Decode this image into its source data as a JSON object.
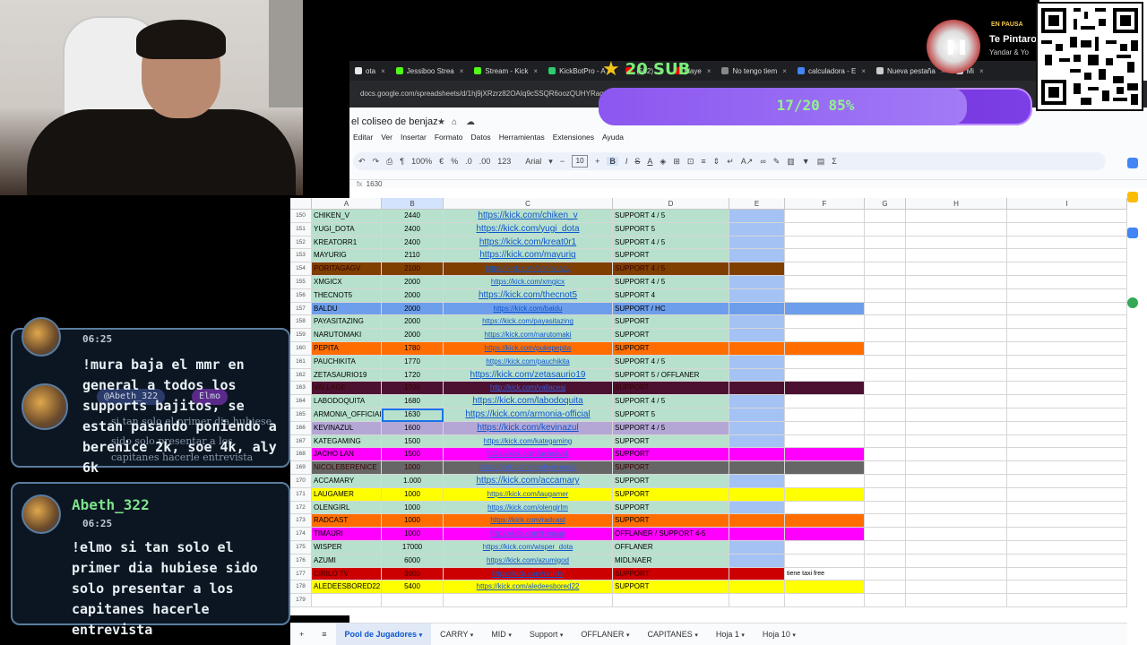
{
  "overlay": {
    "sub_count": "20 SUB",
    "progress_text": "17/20  85%",
    "progress_fraction": 0.85,
    "music_status": "EN PAUSA",
    "music_title": "Te Pintaro",
    "music_artist": "Yandar & Yo"
  },
  "chat": {
    "msg1_time": "06:25",
    "msg1_text": "!mura baja el mmr en general a todos los supports bajitos, se estan pasando poniendo a berenice 2k, soe 4k, aly 6k",
    "ghost_tag1": "@Abeth_322",
    "ghost_tag2": "Elmo",
    "ghost_text1": "si tan solo el primer dia hubiese",
    "ghost_text2": "sido solo presentar a los",
    "ghost_text3": "capitanes hacerle entrevista",
    "msg2_user": "Abeth_322",
    "msg2_time": "06:25",
    "msg2_text": "!elmo si tan solo el primer dia hubiese sido solo presentar a los capitanes hacerle entrevista"
  },
  "browser": {
    "tabs": [
      {
        "label": "ota",
        "color": "#e7e7e7"
      },
      {
        "label": "Jessiboo Strea",
        "color": "#53fc18"
      },
      {
        "label": "Stream - Kick",
        "color": "#53fc18"
      },
      {
        "label": "KickBotPro - A",
        "color": "#2ecc71"
      },
      {
        "label": "(502)",
        "color": "#ff0000"
      },
      {
        "label": "playe",
        "color": "#ff0000"
      },
      {
        "label": "No tengo tiem",
        "color": "#888888"
      },
      {
        "label": "calculadora - E",
        "color": "#4285f4"
      },
      {
        "label": "Nueva pestaña",
        "color": "#cccccc"
      },
      {
        "label": "Mi",
        "color": "#cccccc"
      }
    ],
    "url": "docs.google.com/spreadsheets/d/1hj9jXRzrz82OAIq9cSSQR6oozQUHYRagcCXHCaaIH5"
  },
  "sheet": {
    "doc_name": "el coliseo de benjaz",
    "menus": [
      "Editar",
      "Ver",
      "Insertar",
      "Formato",
      "Datos",
      "Herramientas",
      "Extensiones",
      "Ayuda"
    ],
    "zoom": "100%",
    "font": "Arial",
    "font_size": "10",
    "formula_value": "1630",
    "col_headers": [
      "A",
      "B",
      "C",
      "D",
      "E",
      "F",
      "G",
      "H",
      "I"
    ],
    "rows": [
      {
        "n": "150",
        "a": "CHIKEN_V",
        "b": "2440",
        "c": "https://kick.com/chiken_v",
        "d": "SUPPORT 4 / 5",
        "bg": "#b7e1cd",
        "ext": false,
        "big": true
      },
      {
        "n": "151",
        "a": "YUGI_DOTA",
        "b": "2400",
        "c": "https://kick.com/yugi_dota",
        "d": "SUPPORT 5",
        "bg": "#b7e1cd",
        "ext": false,
        "big": true
      },
      {
        "n": "152",
        "a": "KREATORR1",
        "b": "2400",
        "c": "https://kick.com/kreat0r1",
        "d": "SUPPORT 4 / 5",
        "bg": "#b7e1cd",
        "ext": false,
        "big": true
      },
      {
        "n": "153",
        "a": "MAYURIG",
        "b": "2110",
        "c": "https://kick.com/mayurig",
        "d": "SUPPORT",
        "bg": "#b7e1cd",
        "ext": false,
        "big": true
      },
      {
        "n": "154",
        "a": "PORITAGAGV",
        "b": "2100",
        "c": "https://kick.com/poritagagv",
        "d": "SUPPORT 4 / 5",
        "bg": "#7f3f00",
        "ext": false,
        "dark": true
      },
      {
        "n": "155",
        "a": "XMGICX",
        "b": "2000",
        "c": "https://kick.com/xmgicx",
        "d": "SUPPORT 4 / 5",
        "bg": "#b7e1cd",
        "ext": false
      },
      {
        "n": "156",
        "a": "THECNOT5",
        "b": "2000",
        "c": "https://kick.com/thecnot5",
        "d": "SUPPORT 4",
        "bg": "#b7e1cd",
        "ext": false,
        "big": true
      },
      {
        "n": "157",
        "a": "BALDU",
        "b": "2000",
        "c": "https://kick.com/baldu",
        "d": "SUPPORT / HC",
        "bg": "#6d9eeb",
        "ext": true
      },
      {
        "n": "158",
        "a": "PAYASITAZING",
        "b": "2000",
        "c": "https://kick.com/payasitazing",
        "d": "SUPPORT",
        "bg": "#b7e1cd",
        "ext": false
      },
      {
        "n": "159",
        "a": "NARUTOMAKI",
        "b": "2000",
        "c": "https://kick.com/narutomaki",
        "d": "SUPPORT",
        "bg": "#b7e1cd",
        "ext": false
      },
      {
        "n": "160",
        "a": "PEPITA",
        "b": "1780",
        "c": "https://kick.com/pukepepita",
        "d": "SUPPORT",
        "bg": "#ff6d01",
        "ext": true
      },
      {
        "n": "161",
        "a": "PAUCHIKITA",
        "b": "1770",
        "c": "https://kick.com/pauchikita",
        "d": "SUPPORT 4 / 5",
        "bg": "#b7e1cd",
        "ext": false
      },
      {
        "n": "162",
        "a": "ZETASAURIO19",
        "b": "1720",
        "c": "https://kick.com/zetasaurio19",
        "d": "SUPPORT 5 / OFFLANER",
        "bg": "#b7e1cd",
        "ext": false,
        "big": true
      },
      {
        "n": "163",
        "a": "VALLAGE",
        "b": "1700",
        "c": "http://kick.com/vallacesj",
        "d": "SUPPORT",
        "bg": "#4c1130",
        "ext": true,
        "dark": true
      },
      {
        "n": "164",
        "a": "LABODOQUITA",
        "b": "1680",
        "c": "https://kick.com/labodoquita",
        "d": "SUPPORT 4 / 5",
        "bg": "#b7e1cd",
        "ext": false,
        "big": true
      },
      {
        "n": "165",
        "a": "ARMONIA_OFFICIAL",
        "b": "1630",
        "c": "https://kick.com/armonia-official",
        "d": "SUPPORT 5",
        "bg": "#b7e1cd",
        "ext": false,
        "big": true,
        "sel": true
      },
      {
        "n": "166",
        "a": "KEVINAZUL",
        "b": "1600",
        "c": "https://kick.com/kevinazul",
        "d": "SUPPORT 4 / 5",
        "bg": "#b4a7d6",
        "ext": false,
        "big": true
      },
      {
        "n": "167",
        "a": "KATEGAMING",
        "b": "1500",
        "c": "https://kick.com/kategaming",
        "d": "SUPPORT",
        "bg": "#b7e1cd",
        "ext": false
      },
      {
        "n": "168",
        "a": "JACHO LAN",
        "b": "1500",
        "c": "https://kick.com/jacholan1",
        "d": "SUPPORT",
        "bg": "#ff00ff",
        "ext": true
      },
      {
        "n": "169",
        "a": "NICOLEBERENICE",
        "b": "1000",
        "c": "https://kick.com/nicoleberenice",
        "d": "SUPPORT",
        "bg": "#666666",
        "ext": true,
        "dark": true
      },
      {
        "n": "170",
        "a": "ACCAMARY",
        "b": "1.000",
        "c": "https://kick.com/accamary",
        "d": "SUPPORT",
        "bg": "#b7e1cd",
        "ext": false,
        "big": true
      },
      {
        "n": "171",
        "a": "LAUGAMER",
        "b": "1000",
        "c": "https://kick.com/laugamer",
        "d": "SUPPORT",
        "bg": "#ffff00",
        "ext": true
      },
      {
        "n": "172",
        "a": "OLENGIRL",
        "b": "1000",
        "c": "https://kick.com/olengirlm",
        "d": "SUPPORT",
        "bg": "#b7e1cd",
        "ext": false
      },
      {
        "n": "173",
        "a": "RADCAST",
        "b": "1000",
        "c": "https://kick.com/radcast",
        "d": "SUPPORT",
        "bg": "#ff6d01",
        "ext": true
      },
      {
        "n": "174",
        "a": "TIMAURI",
        "b": "1000",
        "c": "https://kick.com/t-imauri",
        "d": "OFFLANER / SUPPORT 4-5",
        "bg": "#ff00ff",
        "ext": true
      },
      {
        "n": "175",
        "a": "WISPER",
        "b": "17000",
        "c": "https://kick.com/wisper_dota",
        "d": "OFFLANER",
        "bg": "#b7e1cd",
        "ext": false
      },
      {
        "n": "176",
        "a": "AZUMI",
        "b": "6000",
        "c": "https://kick.com/azumigod",
        "d": "MIDLNAER",
        "bg": "#b7e1cd",
        "ext": false
      },
      {
        "n": "177",
        "a": "CIRILO TV",
        "b": "3900",
        "c": "https://kick.com/cirilotv",
        "d": "SUPPORT",
        "bg": "#cc0000",
        "ext": false,
        "dark": true,
        "note": "tiene taxi free"
      },
      {
        "n": "178",
        "a": "ALEDEESBORED22",
        "b": "5400",
        "c": "https://kick.com/aledeesbored22",
        "d": "SUPPORT",
        "bg": "#ffff00",
        "ext": true
      },
      {
        "n": "179",
        "a": "",
        "b": "",
        "c": "",
        "d": "",
        "bg": "#ffffff",
        "ext": false
      }
    ],
    "sheet_tabs": [
      "Pool de Jugadores",
      "CARRY",
      "MID",
      "Support",
      "OFFLANER",
      "CAPITANES",
      "Hoja 1",
      "Hoja 10"
    ]
  }
}
